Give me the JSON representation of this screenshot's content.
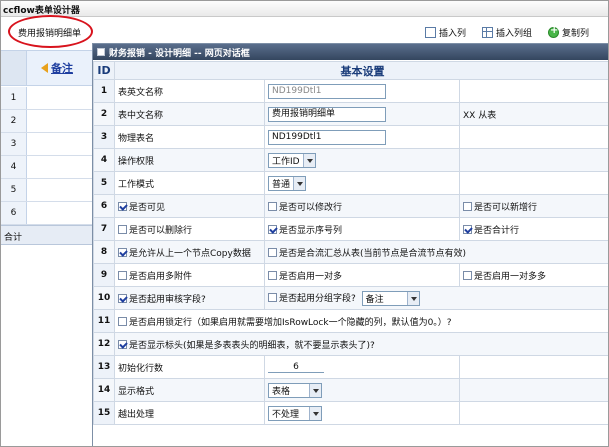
{
  "window": {
    "title": "ccflow表单设计器"
  },
  "form_tab": {
    "label": "费用报销明细单"
  },
  "toolbar": [
    {
      "label": "插入列",
      "icon": "insert-column-icon"
    },
    {
      "label": "插入列组",
      "icon": "insert-column-group-icon"
    },
    {
      "label": "复制列",
      "icon": "copy-column-icon"
    }
  ],
  "grid": {
    "column_header": "备注",
    "rows": [
      "1",
      "2",
      "3",
      "4",
      "5",
      "6"
    ],
    "total_label": "合计"
  },
  "dialog": {
    "title": "财务报销 - 设计明细 -- 网页对话框",
    "header": {
      "id": "ID",
      "title": "基本设置"
    },
    "rows": {
      "r1": {
        "id": "1",
        "label": "表英文名称",
        "value": "ND199Dtl1"
      },
      "r2": {
        "id": "2",
        "label": "表中文名称",
        "value": "费用报销明细单",
        "note": "XX 从表"
      },
      "r3": {
        "id": "3",
        "label": "物理表名",
        "value": "ND199Dtl1"
      },
      "r4": {
        "id": "4",
        "label": "操作权限",
        "value": "工作ID"
      },
      "r5": {
        "id": "5",
        "label": "工作模式",
        "value": "普通"
      },
      "r6": {
        "id": "6",
        "a": "是否可见",
        "b": "是否可以修改行",
        "c": "是否可以新增行"
      },
      "r7": {
        "id": "7",
        "a": "是否可以删除行",
        "b": "是否显示序号列",
        "c": "是否合计行"
      },
      "r8": {
        "id": "8",
        "a": "是允许从上一个节点Copy数据",
        "b": "是否是合流汇总从表(当前节点是合流节点有效)"
      },
      "r9": {
        "id": "9",
        "a": "是否启用多附件",
        "b": "是否启用一对多",
        "c": "是否启用一对多多"
      },
      "r10": {
        "id": "10",
        "a": "是否起用审核字段?",
        "b": "是否起用分组字段?",
        "b_value": "备注"
      },
      "r11": {
        "id": "11",
        "a": "是否启用锁定行（如果启用就需要增加IsRowLock一个隐藏的列，默认值为0。）?"
      },
      "r12": {
        "id": "12",
        "a": "是否显示标头(如果是多表表头的明细表，就不要显示表头了)?"
      },
      "r13": {
        "id": "13",
        "label": "初始化行数",
        "value": "6"
      },
      "r14": {
        "id": "14",
        "label": "显示格式",
        "value": "表格"
      },
      "r15": {
        "id": "15",
        "label": "越出处理",
        "value": "不处理"
      }
    }
  }
}
